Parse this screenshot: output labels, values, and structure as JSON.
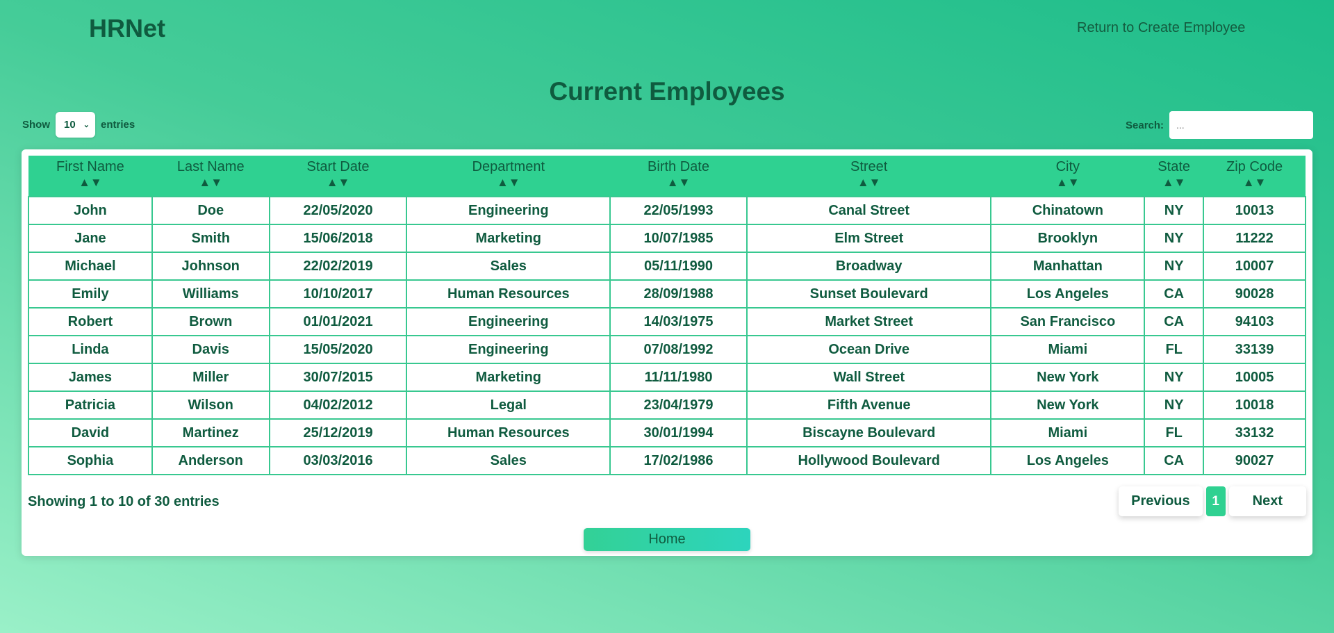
{
  "header": {
    "brand": "HRNet",
    "return_link": "Return to Create Employee"
  },
  "page_title": "Current Employees",
  "length": {
    "show_label": "Show",
    "selected": "10",
    "entries_label": "entries"
  },
  "search": {
    "label": "Search:",
    "placeholder": "..."
  },
  "sort_icon": "▲▼",
  "table": {
    "columns": [
      "First Name",
      "Last Name",
      "Start Date",
      "Department",
      "Birth Date",
      "Street",
      "City",
      "State",
      "Zip Code"
    ],
    "rows": [
      [
        "John",
        "Doe",
        "22/05/2020",
        "Engineering",
        "22/05/1993",
        "Canal Street",
        "Chinatown",
        "NY",
        "10013"
      ],
      [
        "Jane",
        "Smith",
        "15/06/2018",
        "Marketing",
        "10/07/1985",
        "Elm Street",
        "Brooklyn",
        "NY",
        "11222"
      ],
      [
        "Michael",
        "Johnson",
        "22/02/2019",
        "Sales",
        "05/11/1990",
        "Broadway",
        "Manhattan",
        "NY",
        "10007"
      ],
      [
        "Emily",
        "Williams",
        "10/10/2017",
        "Human Resources",
        "28/09/1988",
        "Sunset Boulevard",
        "Los Angeles",
        "CA",
        "90028"
      ],
      [
        "Robert",
        "Brown",
        "01/01/2021",
        "Engineering",
        "14/03/1975",
        "Market Street",
        "San Francisco",
        "CA",
        "94103"
      ],
      [
        "Linda",
        "Davis",
        "15/05/2020",
        "Engineering",
        "07/08/1992",
        "Ocean Drive",
        "Miami",
        "FL",
        "33139"
      ],
      [
        "James",
        "Miller",
        "30/07/2015",
        "Marketing",
        "11/11/1980",
        "Wall Street",
        "New York",
        "NY",
        "10005"
      ],
      [
        "Patricia",
        "Wilson",
        "04/02/2012",
        "Legal",
        "23/04/1979",
        "Fifth Avenue",
        "New York",
        "NY",
        "10018"
      ],
      [
        "David",
        "Martinez",
        "25/12/2019",
        "Human Resources",
        "30/01/1994",
        "Biscayne Boulevard",
        "Miami",
        "FL",
        "33132"
      ],
      [
        "Sophia",
        "Anderson",
        "03/03/2016",
        "Sales",
        "17/02/1986",
        "Hollywood Boulevard",
        "Los Angeles",
        "CA",
        "90027"
      ]
    ]
  },
  "info": "Showing 1 to 10 of 30 entries",
  "pagination": {
    "previous": "Previous",
    "current": "1",
    "next": "Next"
  },
  "home_button": "Home",
  "colors": {
    "accent": "#2fd191",
    "text": "#0f5b3f",
    "border": "#38c890"
  }
}
